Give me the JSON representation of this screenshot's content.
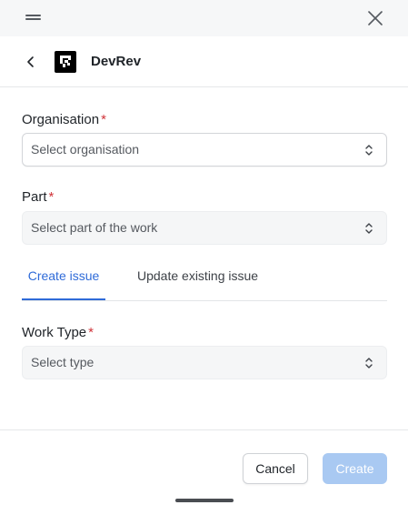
{
  "app": {
    "name": "DevRev"
  },
  "form": {
    "organisation": {
      "label": "Organisation",
      "required_mark": "*",
      "placeholder": "Select organisation"
    },
    "part": {
      "label": "Part",
      "required_mark": "*",
      "placeholder": "Select part of the work"
    },
    "work_type": {
      "label": "Work Type",
      "required_mark": "*",
      "placeholder": "Select type"
    }
  },
  "tabs": [
    {
      "label": "Create issue",
      "active": true
    },
    {
      "label": "Update existing issue",
      "active": false
    }
  ],
  "footer": {
    "cancel_label": "Cancel",
    "create_label": "Create"
  },
  "icons": {
    "drag": "drag-handle-icon",
    "close": "close-icon",
    "back": "chevron-left-icon",
    "logo": "devrev-logo",
    "select": "chevron-updown-icon"
  },
  "colors": {
    "accent": "#2f6bd8",
    "required": "#d0343a",
    "create_disabled": "#a9c9f2",
    "topbar_bg": "#f6f7f8"
  }
}
